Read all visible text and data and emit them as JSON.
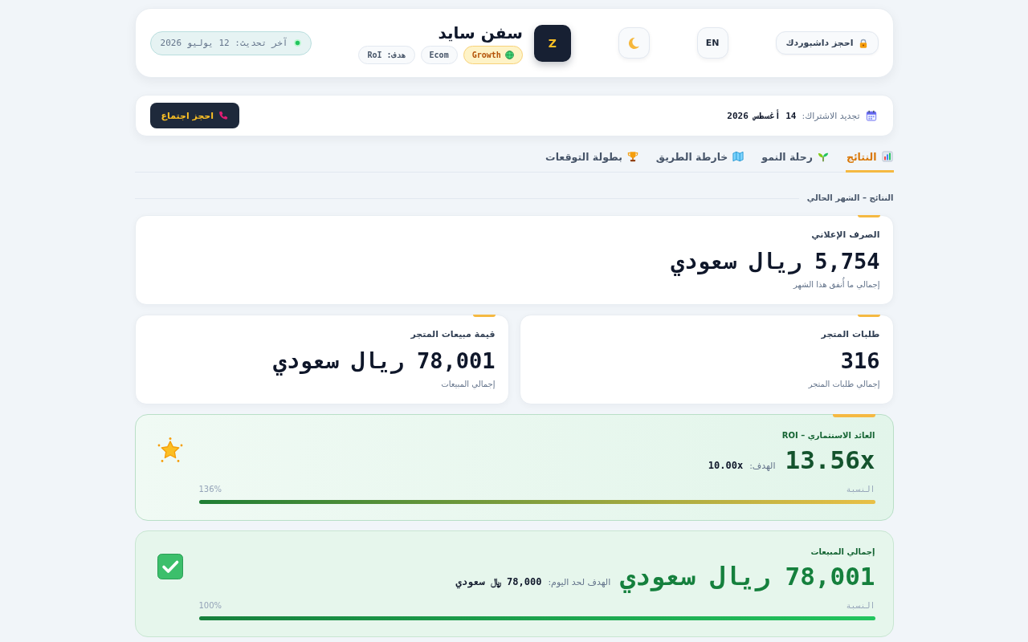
{
  "header": {
    "dashboard_button": {
      "label": "احجز داشبوردك"
    },
    "language_button": {
      "label": "EN"
    },
    "brand": {
      "avatar": "Z",
      "name": "سفن سايد",
      "tags": [
        {
          "kind": "highlight",
          "label": "Growth"
        },
        {
          "kind": "plain",
          "label": "Ecom"
        },
        {
          "kind": "plain",
          "label": "هدف: RoI"
        }
      ]
    },
    "last_update": {
      "label": "آخر تحديث: 12 يوليو 2026"
    }
  },
  "subscription": {
    "label": "تجديد الاشتراك:",
    "date": "14 أغسطس 2026",
    "meeting_button": {
      "label": "احجز اجتماع"
    }
  },
  "tabs": [
    {
      "label": "النتائج",
      "selected": true
    },
    {
      "label": "رحلة النمو",
      "selected": false
    },
    {
      "label": "خارطة الطريق",
      "selected": false
    },
    {
      "label": "بطولة التوقعات",
      "selected": false
    }
  ],
  "section": {
    "title": "النتائج – الشهر الحالي",
    "metric_rows": [
      [
        {
          "label": "الصرف الإعلاني",
          "value": "5,754 ريال سعودي",
          "note": "إجمالي ما أُنفق هذا الشهر"
        }
      ],
      [
        {
          "label": "طلبات المتجر",
          "value": "316",
          "note": "إجمالي طلبات المتجر"
        },
        {
          "label": "قيمة مبيعات المتجر",
          "value": "78,001 ريال سعودي",
          "note": "إجمالي المبيعات"
        }
      ]
    ],
    "goal_cards": [
      {
        "kind": "exceeded",
        "label": "العائد الاستثماري – ROI",
        "value": "13.56x",
        "target_label": "الهدف:",
        "target_value": "10.00x",
        "ratio_label": "النسبة",
        "ratio": "136%",
        "level": 1
      },
      {
        "kind": "met",
        "label": "إجمالي المبيعات",
        "value": "78,001 ريال سعودي",
        "target_label": "الهدف لحد اليوم:",
        "target_value": "78,000 ﷼ سعودي",
        "ratio_label": "النسبة",
        "ratio": "100%",
        "level": 1
      }
    ]
  }
}
